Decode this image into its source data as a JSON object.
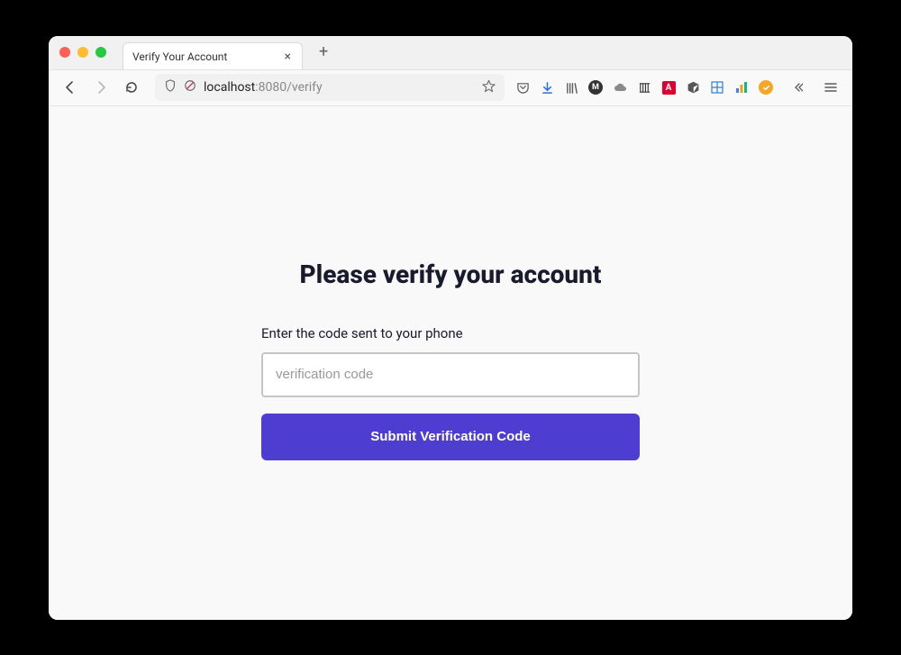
{
  "browser": {
    "tab_title": "Verify Your Account",
    "url_host": "localhost",
    "url_port_path": ":8080/verify"
  },
  "page": {
    "heading": "Please verify your account",
    "field_label": "Enter the code sent to your phone",
    "input_placeholder": "verification code",
    "input_value": "",
    "submit_label": "Submit Verification Code"
  }
}
